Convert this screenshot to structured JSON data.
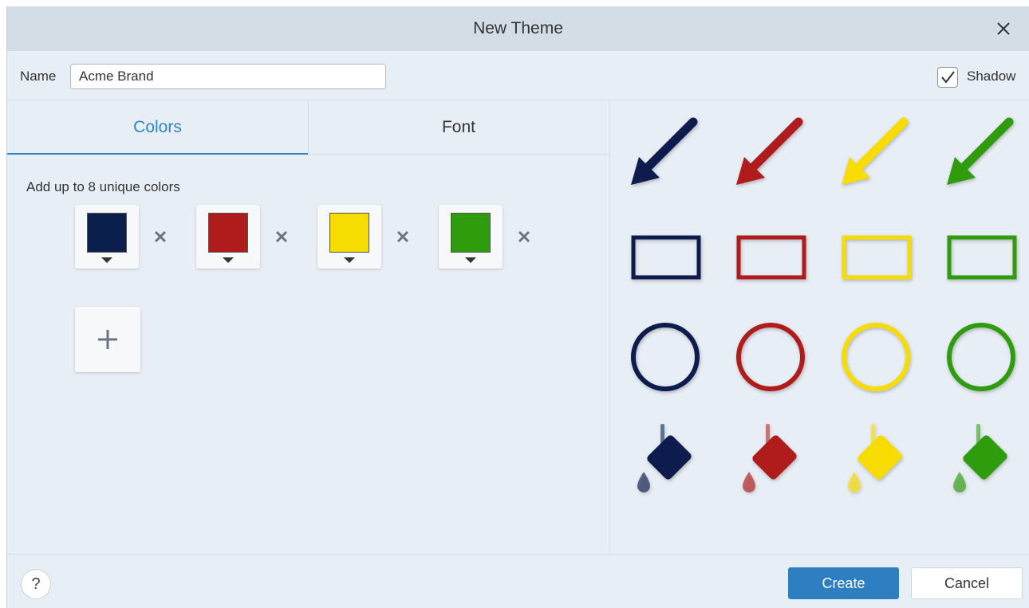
{
  "dialog": {
    "title": "New Theme",
    "close_icon": "close-icon"
  },
  "name_field": {
    "label": "Name",
    "value": "Acme Brand"
  },
  "shadow": {
    "label": "Shadow",
    "checked": true
  },
  "tabs": [
    {
      "label": "Colors",
      "active": true
    },
    {
      "label": "Font",
      "active": false
    }
  ],
  "colors": {
    "hint": "Add up to 8 unique colors",
    "swatches": [
      "#0b1f4d",
      "#b01c1c",
      "#f6dc00",
      "#2e9c0c"
    ],
    "remove_icon": "close-icon",
    "add_icon": "plus-icon"
  },
  "preview": {
    "rows": [
      "arrow",
      "rectangle",
      "circle",
      "fill-bucket"
    ],
    "colors": [
      "#0b1f4d",
      "#b01c1c",
      "#f6dc00",
      "#2e9c0c"
    ]
  },
  "footer": {
    "help_label": "?",
    "create_label": "Create",
    "cancel_label": "Cancel"
  }
}
